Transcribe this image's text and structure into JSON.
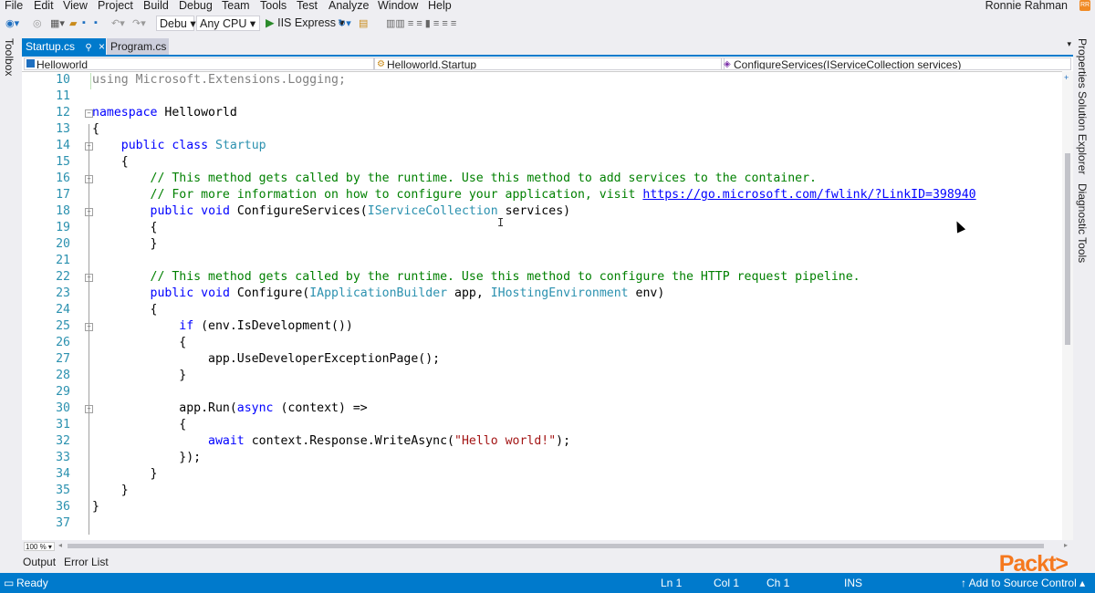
{
  "menu": {
    "items": [
      "File",
      "Edit",
      "View",
      "Project",
      "Build",
      "Debug",
      "Team",
      "Tools",
      "Test",
      "Analyze",
      "Window",
      "Help"
    ],
    "user": "Ronnie Rahman"
  },
  "toolbar": {
    "config": "Debu",
    "platform": "Any CPU",
    "run_target": "IIS Express"
  },
  "side_panels": {
    "left": "Toolbox",
    "right": [
      "Properties",
      "Solution Explorer",
      "Diagnostic Tools"
    ]
  },
  "tabs": [
    {
      "label": "Startup.cs",
      "active": true
    },
    {
      "label": "Program.cs",
      "active": false
    }
  ],
  "navbar": {
    "project": "Helloworld",
    "type": "Helloworld.Startup",
    "member": "ConfigureServices(IServiceCollection services)"
  },
  "code_lines": [
    {
      "n": "10",
      "text": "using Microsoft.Extensions.Logging;"
    },
    {
      "n": "11",
      "text": ""
    },
    {
      "n": "12",
      "text": "namespace Helloworld"
    },
    {
      "n": "13",
      "text": "{"
    },
    {
      "n": "14",
      "text": "    public class Startup"
    },
    {
      "n": "15",
      "text": "    {"
    },
    {
      "n": "16",
      "text": "        // This method gets called by the runtime. Use this method to add services to the container."
    },
    {
      "n": "17",
      "text": "        // For more information on how to configure your application, visit https://go.microsoft.com/fwlink/?LinkID=398940"
    },
    {
      "n": "18",
      "text": "        public void ConfigureServices(IServiceCollection services)"
    },
    {
      "n": "19",
      "text": "        {"
    },
    {
      "n": "20",
      "text": "        }"
    },
    {
      "n": "21",
      "text": ""
    },
    {
      "n": "22",
      "text": "        // This method gets called by the runtime. Use this method to configure the HTTP request pipeline."
    },
    {
      "n": "23",
      "text": "        public void Configure(IApplicationBuilder app, IHostingEnvironment env)"
    },
    {
      "n": "24",
      "text": "        {"
    },
    {
      "n": "25",
      "text": "            if (env.IsDevelopment())"
    },
    {
      "n": "26",
      "text": "            {"
    },
    {
      "n": "27",
      "text": "                app.UseDeveloperExceptionPage();"
    },
    {
      "n": "28",
      "text": "            }"
    },
    {
      "n": "29",
      "text": ""
    },
    {
      "n": "30",
      "text": "            app.Run(async (context) =>"
    },
    {
      "n": "31",
      "text": "            {"
    },
    {
      "n": "32",
      "text": "                await context.Response.WriteAsync(\"Hello world!\");"
    },
    {
      "n": "33",
      "text": "            });"
    },
    {
      "n": "34",
      "text": "        }"
    },
    {
      "n": "35",
      "text": "    }"
    },
    {
      "n": "36",
      "text": "}"
    },
    {
      "n": "37",
      "text": ""
    }
  ],
  "zoom": "100 %",
  "bottom_tabs": [
    "Output",
    "Error List"
  ],
  "status": {
    "state": "Ready",
    "ln": "Ln 1",
    "col": "Col 1",
    "ch": "Ch 1",
    "mode": "INS",
    "source_control": "↑ Add to Source Control ▴"
  },
  "brand": "Packt>",
  "colors": {
    "accent": "#007acc",
    "brand": "#f5781e",
    "keyword": "#0000ff",
    "type": "#2b91af",
    "comment": "#008000",
    "string": "#a31515"
  }
}
